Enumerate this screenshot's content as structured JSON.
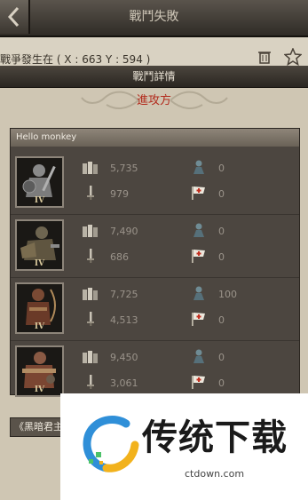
{
  "topbar": {
    "title": "戰鬥失敗"
  },
  "background_row": {
    "text": "戰爭發生在 ( X : 663 Y : 594 )"
  },
  "popup": {
    "title": "戰鬥詳情",
    "side_label": "進攻方",
    "army_name": "Hello monkey",
    "units": [
      {
        "tier": "IV",
        "troops": "5,735",
        "attack": "979",
        "lost": "0",
        "wounded": "0"
      },
      {
        "tier": "IV",
        "troops": "7,490",
        "attack": "686",
        "lost": "0",
        "wounded": "0"
      },
      {
        "tier": "IV",
        "troops": "7,725",
        "attack": "4,513",
        "lost": "100",
        "wounded": "0"
      },
      {
        "tier": "IV",
        "troops": "9,450",
        "attack": "3,061",
        "lost": "0",
        "wounded": "0"
      }
    ],
    "bottom_tab": "《黑暗君主》"
  },
  "watermark": {
    "title": "传统下载",
    "url": "ctdown.com"
  },
  "colors": {
    "accent_red": "#b22a1c",
    "stat_text": "#9a938a",
    "parchment": "#cfc6b3"
  }
}
